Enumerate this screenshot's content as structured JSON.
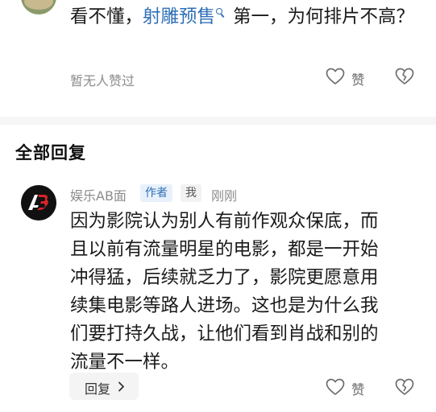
{
  "top_comment": {
    "text_before": "看不懂，",
    "link_text": "射雕预售",
    "text_after": "第一，为何排片不高？",
    "likes_status": "暂无人赞过",
    "like_label": "赞"
  },
  "section": {
    "title": "全部回复"
  },
  "reply": {
    "author": "娱乐AB面",
    "author_tag": "作者",
    "me_tag": "我",
    "time": "刚刚",
    "lines": [
      "因为影院认为别人有前作观众保底，而",
      "且以前有流量明星的电影，都是一开始",
      "冲得猛，后续就乏力了，影院更愿意用",
      "续集电影等路人进场。这也是为什么我",
      "们要打持久战，让他们看到肖战和别的",
      "流量不一样。"
    ],
    "reply_button": "回复",
    "like_label": "赞"
  },
  "colors": {
    "link": "#2f6fb6",
    "meta": "#8c8c8c",
    "text": "#1a1a1a",
    "divider": "#f6f6f6"
  },
  "icons": {
    "search": "search-icon",
    "like": "heart-outline-icon",
    "broken_heart": "broken-heart-icon",
    "chevron": "chevron-right-icon"
  }
}
